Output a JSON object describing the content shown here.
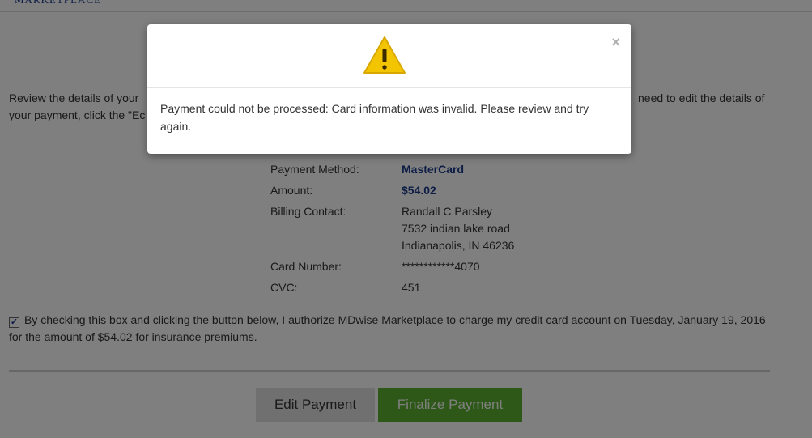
{
  "header": {
    "brand": "MARKETPLACE"
  },
  "intro": {
    "part1": "Review the details of your",
    "part2": "need to edit the details of",
    "part3": "your payment, click the \"Ec"
  },
  "details": {
    "payment_method": {
      "label": "Payment Method:",
      "value": "MasterCard"
    },
    "amount": {
      "label": "Amount:",
      "value": "$54.02"
    },
    "billing": {
      "label": "Billing Contact:",
      "name": "Randall C Parsley",
      "street": "7532 indian lake road",
      "city": "Indianapolis, IN 46236"
    },
    "card_number": {
      "label": "Card Number:",
      "value": "************4070"
    },
    "cvc": {
      "label": "CVC:",
      "value": "451"
    }
  },
  "consent": {
    "checked_mark": "✓",
    "text": "By checking this box and clicking the button below, I authorize MDwise Marketplace to charge my credit card account on Tuesday, January 19, 2016 for the amount of $54.02 for insurance premiums."
  },
  "buttons": {
    "edit_label": "Edit Payment",
    "finalize_label": "Finalize Payment"
  },
  "modal": {
    "close_glyph": "×",
    "message": "Payment could not be processed: Card information was invalid. Please review and try again."
  },
  "colors": {
    "accent_blue": "#1a3a8a",
    "finalize_green": "#5cb131",
    "warning_yellow": "#f2c500"
  },
  "icons": {
    "warning": "warning-icon",
    "close": "close-icon",
    "checkbox": "checkbox-checked"
  }
}
